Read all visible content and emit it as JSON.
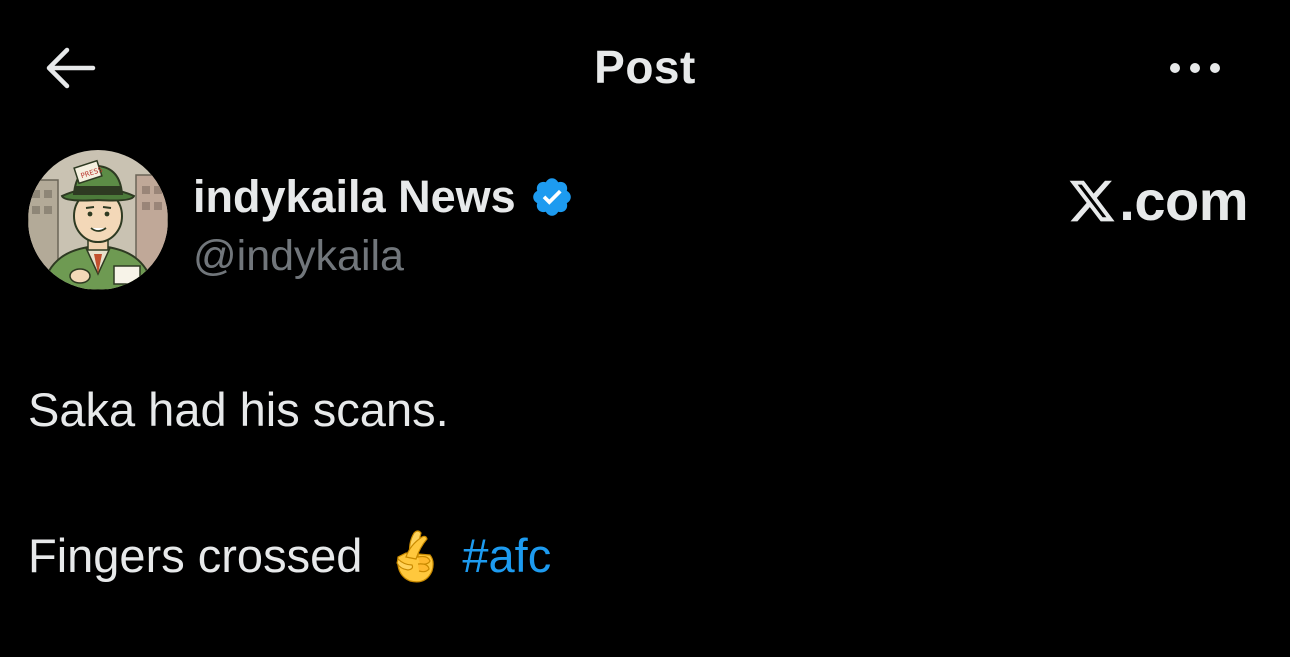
{
  "header": {
    "title": "Post",
    "back_icon": "arrow-left-icon",
    "more_icon": "more-horizontal-icon"
  },
  "author": {
    "name": "indykaila News",
    "handle": "@indykaila",
    "verified": true,
    "verified_color": "#1d9bf0",
    "avatar": "avatar-cartoon-reporter"
  },
  "watermark": {
    "logo": "x-logo-icon",
    "text": ".com"
  },
  "post": {
    "line1": "Saka had his scans.",
    "line2_text": "Fingers crossed",
    "line2_emoji": "crossed-fingers-emoji",
    "hashtag": "#afc"
  },
  "colors": {
    "background": "#000000",
    "text": "#e7e9ea",
    "secondary": "#71767b",
    "accent": "#1d9bf0"
  }
}
